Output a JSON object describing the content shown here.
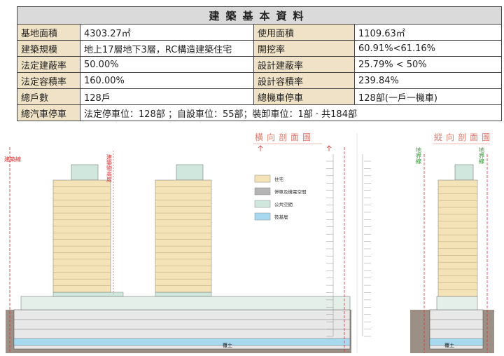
{
  "table": {
    "title": "建築基本資料",
    "rows": [
      {
        "l1": "基地面積",
        "v1": "4303.27㎡",
        "l2": "使用面積",
        "v2": "1109.63㎡"
      },
      {
        "l1": "建築規模",
        "v1": "地上17層地下3層，RC構造建築住宅",
        "l2": "開挖率",
        "v2": "60.91%<61.16%"
      },
      {
        "l1": "法定建蔽率",
        "v1": "50.00%",
        "l2": "設計建蔽率",
        "v2": "25.79% < 50%"
      },
      {
        "l1": "法定容積率",
        "v1": "160.00%",
        "l2": "設計容積率",
        "v2": "239.84%"
      },
      {
        "l1": "總戶數",
        "v1": "128戶",
        "l2": "總機車停車",
        "v2": "128部(一戶一機車)"
      }
    ],
    "last_label": "總汽車停車",
    "last_value": "法定停車位：128部 ；自設車位：55部；裝卸車位：1部 · 共184部"
  },
  "diagram": {
    "title_left": "橫向剖面圖",
    "title_right": "縱向剖面圖",
    "building_line": "建築線",
    "height_label": "建築物高度",
    "boundary_left": "地界線",
    "boundary_right": "地界線",
    "underground": "覆土",
    "legend": [
      {
        "label": "住宅",
        "color": "#f3e3b6"
      },
      {
        "label": "停車及機電空間",
        "color": "#b4b4b4"
      },
      {
        "label": "公共空間",
        "color": "#cfe7dc"
      },
      {
        "label": "筏基層",
        "color": "#a8d8ee"
      }
    ]
  }
}
